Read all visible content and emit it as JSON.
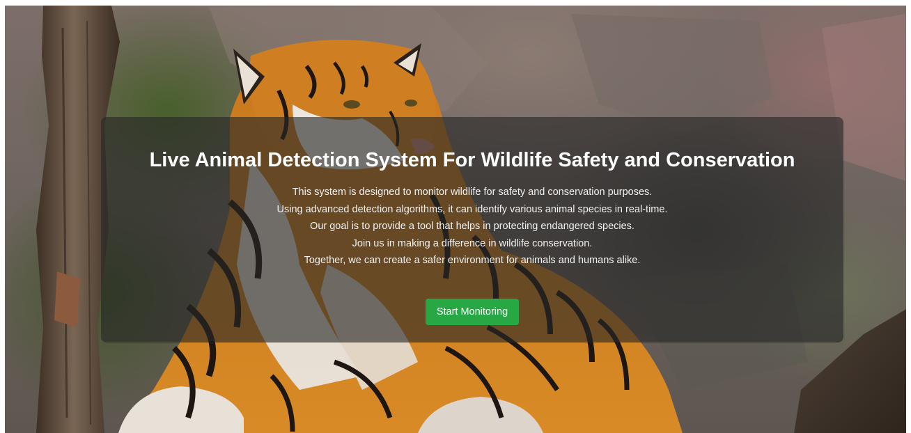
{
  "hero": {
    "background_image": "tiger-lying-on-rock-photo",
    "accent_color": "#28a745",
    "overlay_color": "#262626"
  },
  "overlay": {
    "title": "Live Animal Detection System For Wildlife Safety and Conservation",
    "description_lines": [
      "This system is designed to monitor wildlife for safety and conservation purposes.",
      "Using advanced detection algorithms, it can identify various animal species in real-time.",
      "Our goal is to provide a tool that helps in protecting endangered species.",
      "Join us in making a difference in wildlife conservation.",
      "Together, we can create a safer environment for animals and humans alike."
    ],
    "cta_label": "Start Monitoring"
  }
}
